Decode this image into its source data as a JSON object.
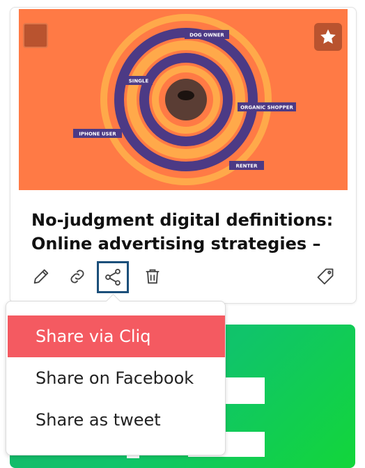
{
  "card": {
    "title": "No-judgment digital definitions: Online advertising strategies –",
    "image_labels": [
      "DOG OWNER",
      "SINGLE",
      "ORGANIC SHOPPER",
      "IPHONE USER",
      "RENTER"
    ],
    "image_bg": "#ff7a45",
    "icons": [
      "edit-icon",
      "link-icon",
      "share-icon",
      "trash-icon",
      "tag-icon",
      "star-icon"
    ]
  },
  "share_menu": {
    "items": [
      {
        "label": "Share via Cliq",
        "active": true
      },
      {
        "label": "Share on Facebook",
        "active": false
      },
      {
        "label": "Share as tweet",
        "active": false
      }
    ],
    "accent": "#f45a61"
  }
}
